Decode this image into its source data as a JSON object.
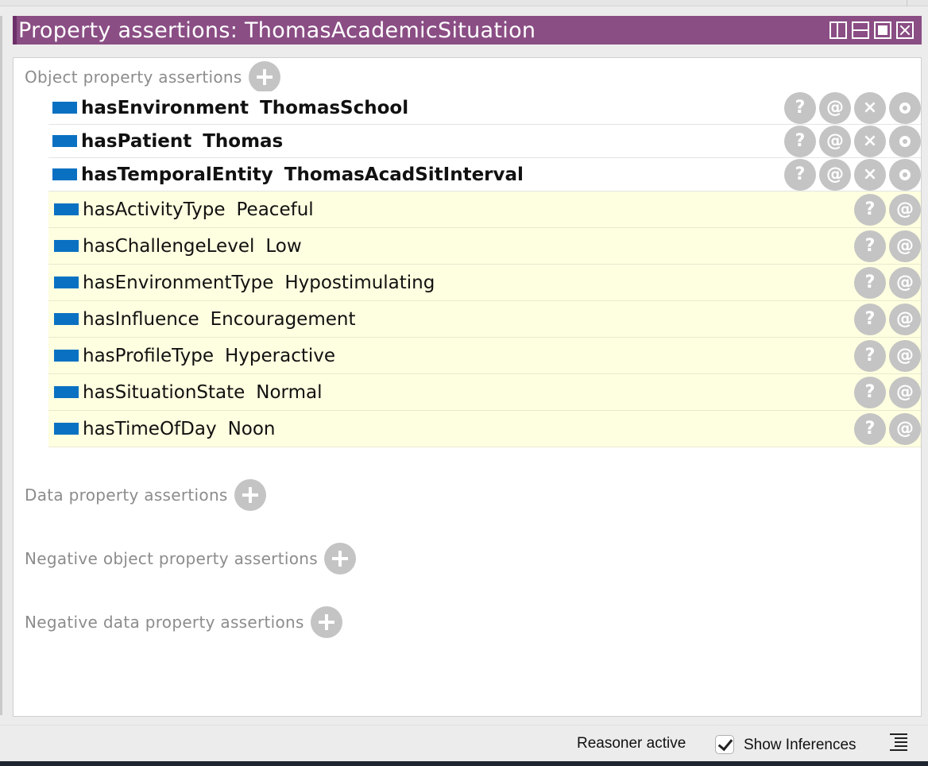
{
  "window": {
    "title": "Property assertions: ThomasAcademicSituation"
  },
  "sections": {
    "object_property": "Object property assertions",
    "data_property": "Data property assertions",
    "negative_object_property": "Negative object property assertions",
    "negative_data_property": "Negative data property assertions"
  },
  "row_buttons": {
    "explain": "?",
    "annotate": "@",
    "delete": "×"
  },
  "asserted_rows": [
    {
      "property": "hasEnvironment",
      "value": "ThomasSchool"
    },
    {
      "property": "hasPatient",
      "value": "Thomas"
    },
    {
      "property": "hasTemporalEntity",
      "value": "ThomasAcadSitInterval"
    }
  ],
  "inferred_rows": [
    {
      "property": "hasActivityType",
      "value": "Peaceful"
    },
    {
      "property": "hasChallengeLevel",
      "value": "Low"
    },
    {
      "property": "hasEnvironmentType",
      "value": "Hypostimulating"
    },
    {
      "property": "hasInfluence",
      "value": "Encouragement"
    },
    {
      "property": "hasProfileType",
      "value": "Hyperactive"
    },
    {
      "property": "hasSituationState",
      "value": "Normal"
    },
    {
      "property": "hasTimeOfDay",
      "value": "Noon"
    }
  ],
  "colors": {
    "titlebar": "#8a4d84",
    "property_icon": "#0a71c2",
    "inferred_background": "#fefee0",
    "button_gray": "#c4c4c4"
  },
  "statusbar": {
    "reasoner_status": "Reasoner active",
    "show_inferences_label": "Show Inferences",
    "show_inferences_checked": true
  }
}
